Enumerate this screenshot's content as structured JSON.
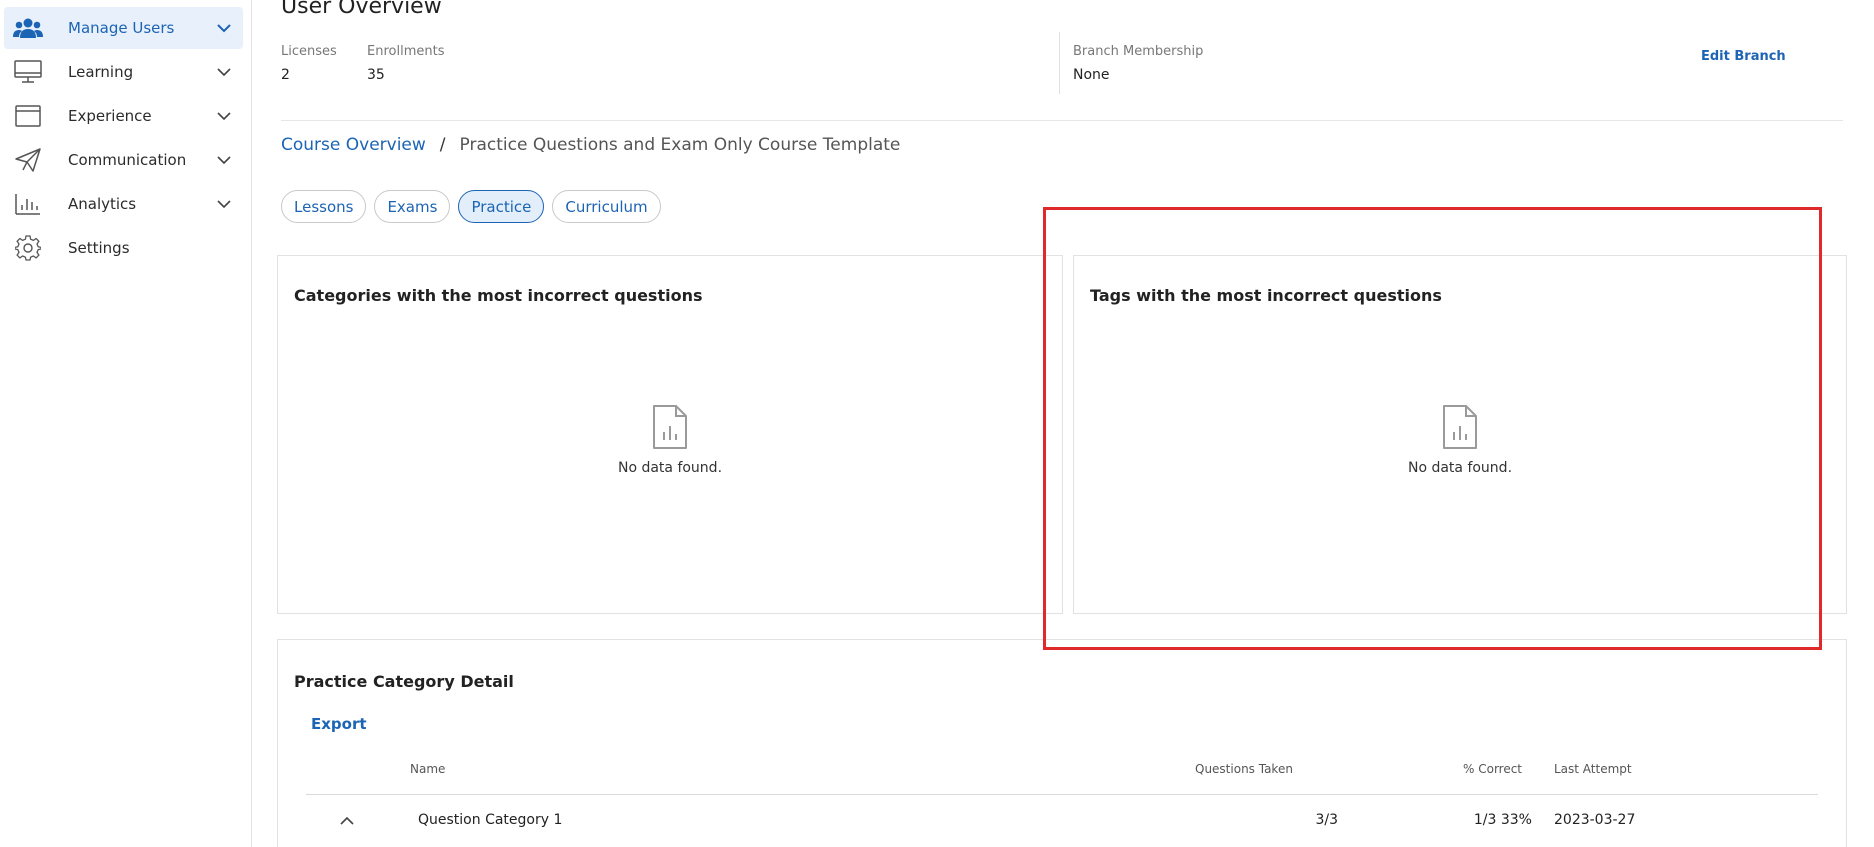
{
  "sidebar": {
    "items": [
      {
        "label": "Manage Users",
        "icon": "users-icon",
        "active": true
      },
      {
        "label": "Learning",
        "icon": "monitor-icon"
      },
      {
        "label": "Experience",
        "icon": "browser-window-icon"
      },
      {
        "label": "Communication",
        "icon": "paper-plane-icon"
      },
      {
        "label": "Analytics",
        "icon": "bar-chart-icon"
      },
      {
        "label": "Settings",
        "icon": "gear-icon"
      }
    ]
  },
  "header": {
    "title": "User Overview",
    "licenses_label": "Licenses",
    "licenses_value": "2",
    "enrollments_label": "Enrollments",
    "enrollments_value": "35",
    "branch_label": "Branch Membership",
    "branch_value": "None",
    "edit_branch": "Edit Branch"
  },
  "breadcrumb": {
    "link": "Course Overview",
    "separator": "/",
    "current": "Practice Questions and Exam Only Course Template"
  },
  "tabs": [
    {
      "label": "Lessons"
    },
    {
      "label": "Exams"
    },
    {
      "label": "Practice",
      "active": true
    },
    {
      "label": "Curriculum"
    }
  ],
  "cards": {
    "categories": {
      "title": "Categories with the most incorrect questions",
      "empty": "No data found."
    },
    "tags": {
      "title": "Tags with the most incorrect questions",
      "empty": "No data found."
    }
  },
  "detail": {
    "title": "Practice Category Detail",
    "export": "Export",
    "columns": [
      "Name",
      "Questions Taken",
      "% Correct",
      "Last Attempt"
    ],
    "rows": [
      {
        "name": "Question Category 1",
        "questions_taken": "3/3",
        "percent_correct": "1/3 33%",
        "last_attempt": "2023-03-27"
      }
    ]
  },
  "colors": {
    "accent": "#1c64b4",
    "highlight": "#e02a2a",
    "active_bg": "#e8f0fb"
  }
}
